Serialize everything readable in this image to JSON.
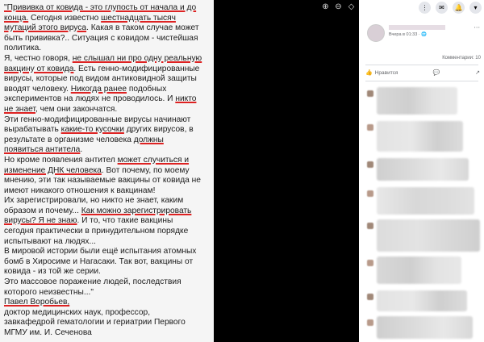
{
  "photo": {
    "lines": [
      [
        {
          "t": "\"Прививка от ковида - это глупость от начала и до",
          "u": true
        }
      ],
      [
        {
          "t": "конца.",
          "u": true
        },
        {
          "t": " Сегодня известно ",
          "u": false
        },
        {
          "t": "шестнадцать тысяч",
          "u": true
        }
      ],
      [
        {
          "t": "мутаций этого вируса",
          "u": true
        },
        {
          "t": ". Какая в таком случае может",
          "u": false
        }
      ],
      [
        {
          "t": "быть прививка?.. Ситуация с ковидом - чистейшая",
          "u": false
        }
      ],
      [
        {
          "t": "политика.",
          "u": false
        }
      ],
      [
        {
          "t": "Я, честно говоря, ",
          "u": false
        },
        {
          "t": "не слышал ни про одну реальную",
          "u": true
        }
      ],
      [
        {
          "t": "вакцину от ковида",
          "u": true
        },
        {
          "t": ". Есть генно-модифицированные",
          "u": false
        }
      ],
      [
        {
          "t": "вирусы, которые под видом антиковидной защиты",
          "u": false
        }
      ],
      [
        {
          "t": "вводят человеку. ",
          "u": false
        },
        {
          "t": "Никогда ранее",
          "u": true
        },
        {
          "t": " подобных",
          "u": false
        }
      ],
      [
        {
          "t": "экспериментов на людях не проводилось. И ",
          "u": false
        },
        {
          "t": "никто",
          "u": true
        }
      ],
      [
        {
          "t": "не знает",
          "u": true
        },
        {
          "t": ", чем они закончатся.",
          "u": false
        }
      ],
      [
        {
          "t": "Эти генно-модифицированные вирусы начинают",
          "u": false
        }
      ],
      [
        {
          "t": "вырабатывать ",
          "u": false
        },
        {
          "t": "какие-то кусочки",
          "u": true
        },
        {
          "t": " других вирусов, в",
          "u": false
        }
      ],
      [
        {
          "t": "результате в организме человека ",
          "u": false
        },
        {
          "t": "должны",
          "u": true
        }
      ],
      [
        {
          "t": "появиться антитела",
          "u": true
        },
        {
          "t": ".",
          "u": false
        }
      ],
      [
        {
          "t": "Но кроме появления антител ",
          "u": false
        },
        {
          "t": "может случиться и",
          "u": true
        }
      ],
      [
        {
          "t": "изменение ДНК человека",
          "u": true
        },
        {
          "t": ". Вот почему, по моему",
          "u": false
        }
      ],
      [
        {
          "t": "мнению, эти так называемые вакцины от ковида не",
          "u": false
        }
      ],
      [
        {
          "t": "имеют никакого отношения к вакцинам!",
          "u": false
        }
      ],
      [
        {
          "t": "Их зарегистрировали, но никто не знает, каким",
          "u": false
        }
      ],
      [
        {
          "t": "образом и почему... ",
          "u": false
        },
        {
          "t": "Как можно зарегистрировать",
          "u": true
        }
      ],
      [
        {
          "t": "вирусы? Я не знаю",
          "u": true
        },
        {
          "t": ". И то, что такие вакцины",
          "u": false
        }
      ],
      [
        {
          "t": "сегодня практически в принудительном порядке",
          "u": false
        }
      ],
      [
        {
          "t": "испытывают на людях...",
          "u": false
        }
      ],
      [
        {
          "t": "В мировой истории были ещё испытания атомных",
          "u": false
        }
      ],
      [
        {
          "t": "бомб в Хиросиме и Нагасаки. Так вот, вакцины от",
          "u": false
        }
      ],
      [
        {
          "t": "ковида - из той же серии.",
          "u": false
        }
      ],
      [
        {
          "t": "Это массовое поражение людей, последствия",
          "u": false
        }
      ],
      [
        {
          "t": "которого неизвестны...\"",
          "u": false
        }
      ],
      [
        {
          "t": "Павел Воробьев,",
          "u": true
        }
      ],
      [
        {
          "t": "доктор медицинских наук, профессор,",
          "u": false
        }
      ],
      [
        {
          "t": "завкафедрой гематологии и гериатрии Первого",
          "u": false
        }
      ],
      [
        {
          "t": "МГМУ им. И. Сеченова",
          "u": false
        }
      ]
    ]
  },
  "viewer": {
    "controls": [
      {
        "name": "zoom-in-icon",
        "glyph": "⊕"
      },
      {
        "name": "zoom-out-icon",
        "glyph": "⊖"
      },
      {
        "name": "tag-icon",
        "glyph": "◇"
      },
      {
        "name": "fullscreen-icon",
        "glyph": "⤢"
      }
    ]
  },
  "panel": {
    "post_meta": "Вчера в 01:33 · 🌐",
    "more_icon": "···",
    "comments_count": "Комментарии: 10",
    "like_label": "Нравится",
    "like_icon": "👍",
    "comment_icon": "💬",
    "share_icon": "↗",
    "top_icons": [
      {
        "name": "menu-grid-icon",
        "glyph": "⋮"
      },
      {
        "name": "messenger-icon",
        "glyph": "✉"
      },
      {
        "name": "notifications-icon",
        "glyph": "🔔"
      },
      {
        "name": "account-icon",
        "glyph": "▾"
      }
    ]
  },
  "colors": {
    "underline": "#dd2222",
    "panel_bg": "#ffffff",
    "viewer_bg": "#000000",
    "photo_bg": "#f5f5f5"
  }
}
